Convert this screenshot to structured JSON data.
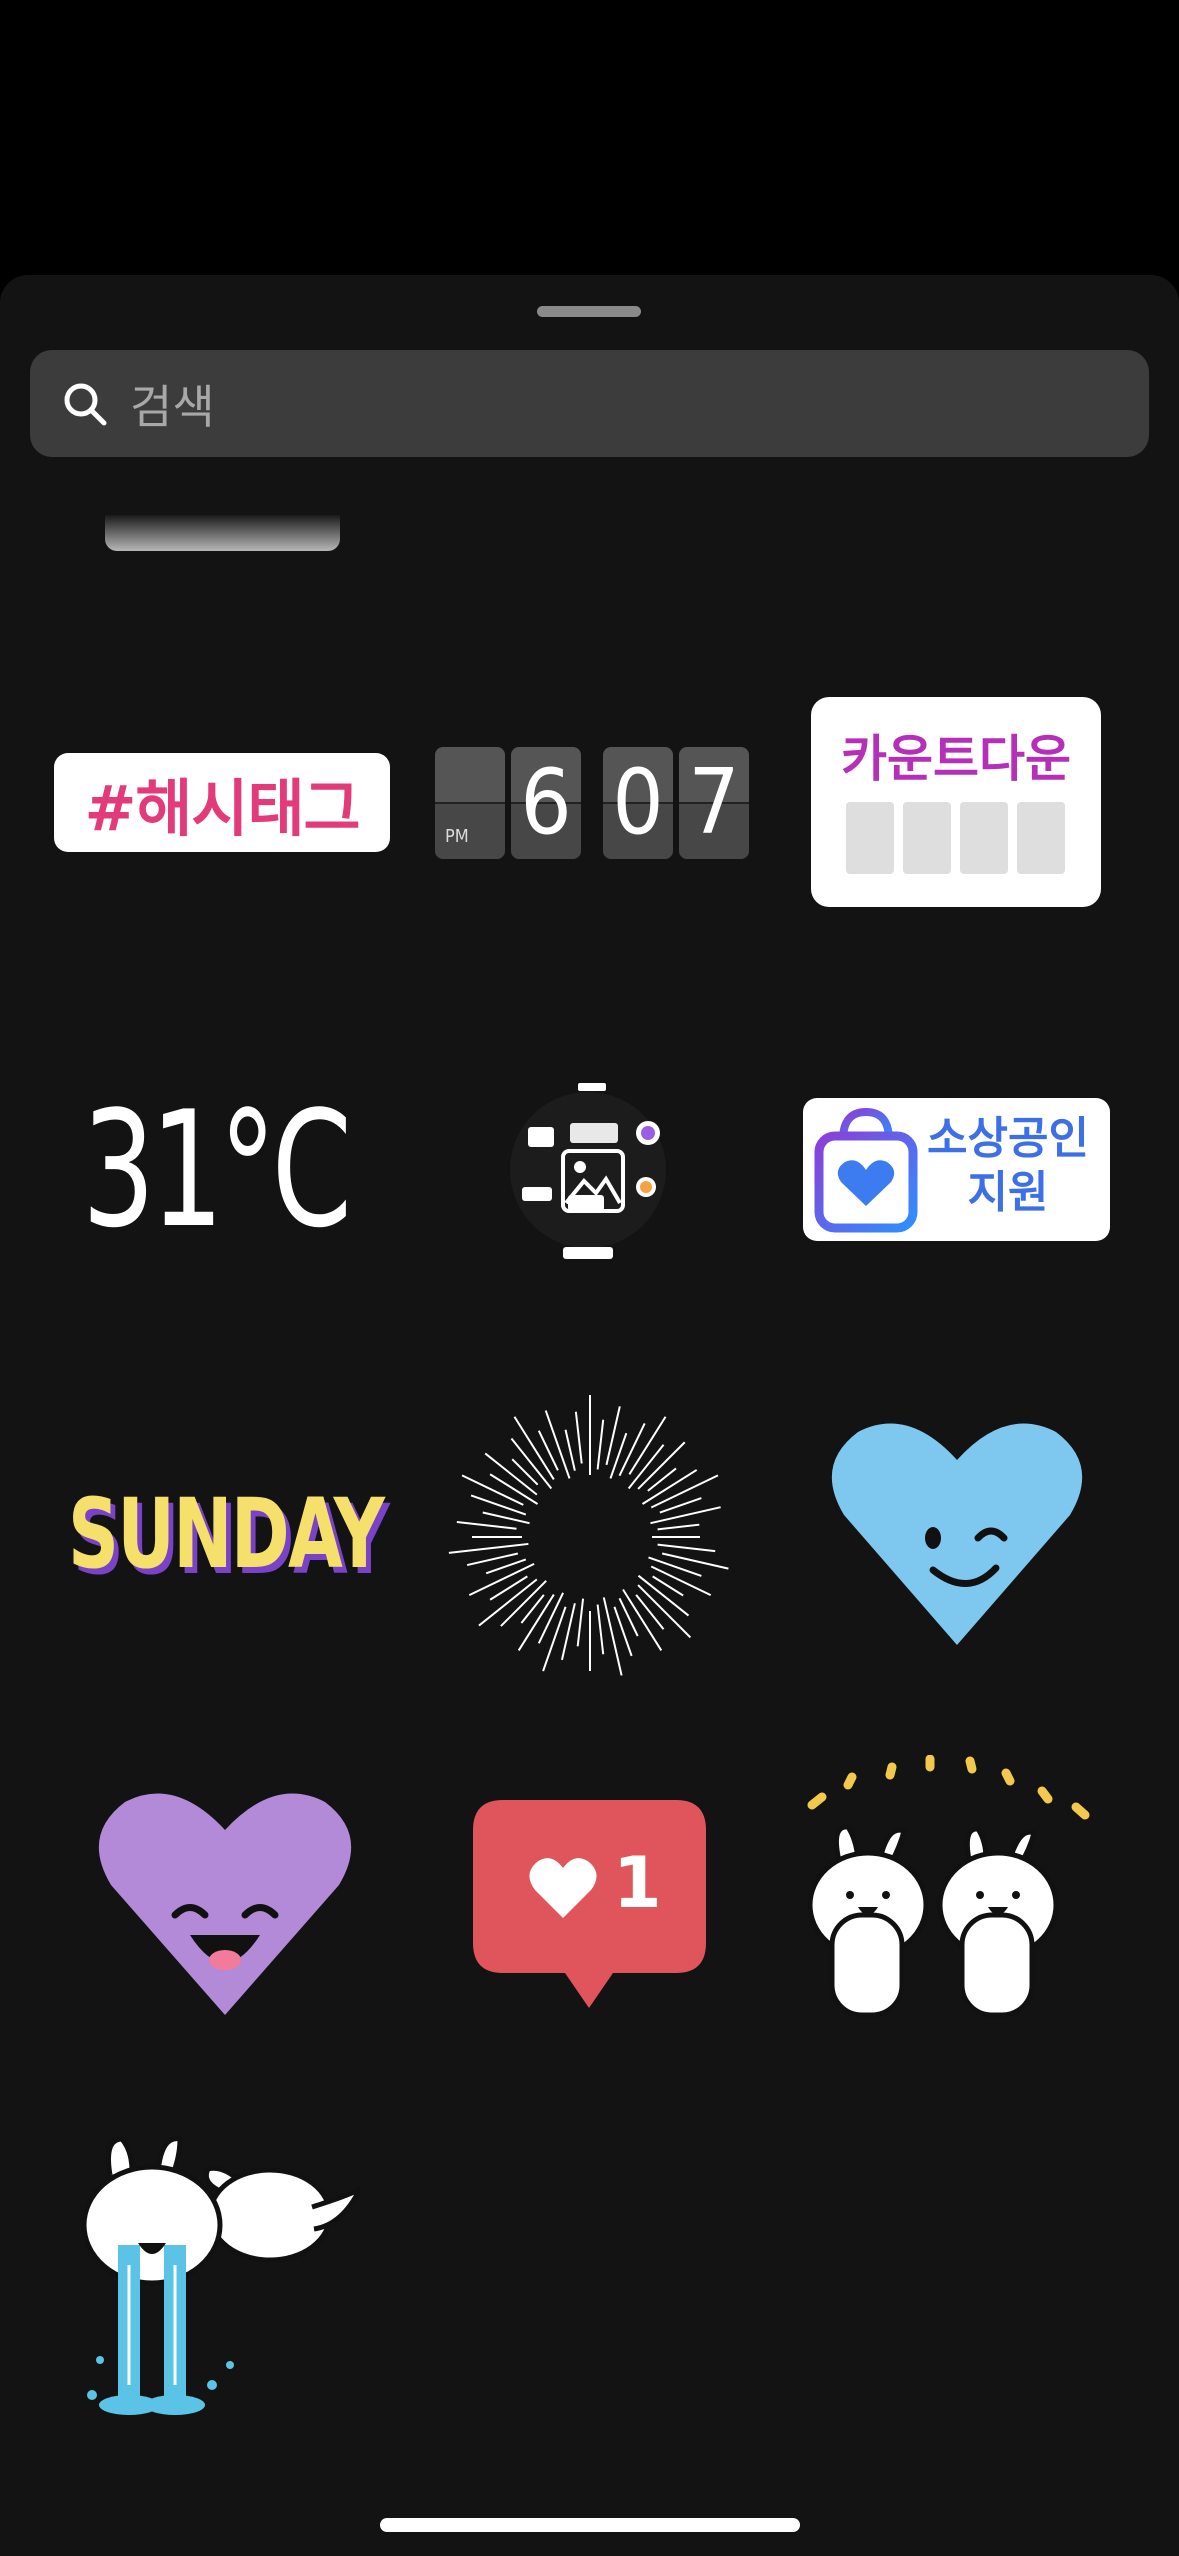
{
  "search": {
    "placeholder": "검색",
    "icon": "search-icon"
  },
  "stickers": {
    "hashtag": "#해시태그",
    "clock": {
      "ampm": "PM",
      "hour": "6",
      "minute_tens": "0",
      "minute_ones": "7"
    },
    "countdown": "카운트다운",
    "temperature": "31°C",
    "small_business": {
      "line1": "소상공인",
      "line2": "지원"
    },
    "day": "SUNDAY",
    "like_count": "1"
  },
  "colors": {
    "hashtag_text": "#e33b7a",
    "countdown_text": "#b52fb8",
    "small_business_text": "#3d6fe6",
    "day_text": "#f5e06b",
    "day_shadow": "#7a42c8",
    "blue_heart": "#7ec8ef",
    "purple_heart": "#b28ad8",
    "like_bubble": "#e0545c"
  }
}
